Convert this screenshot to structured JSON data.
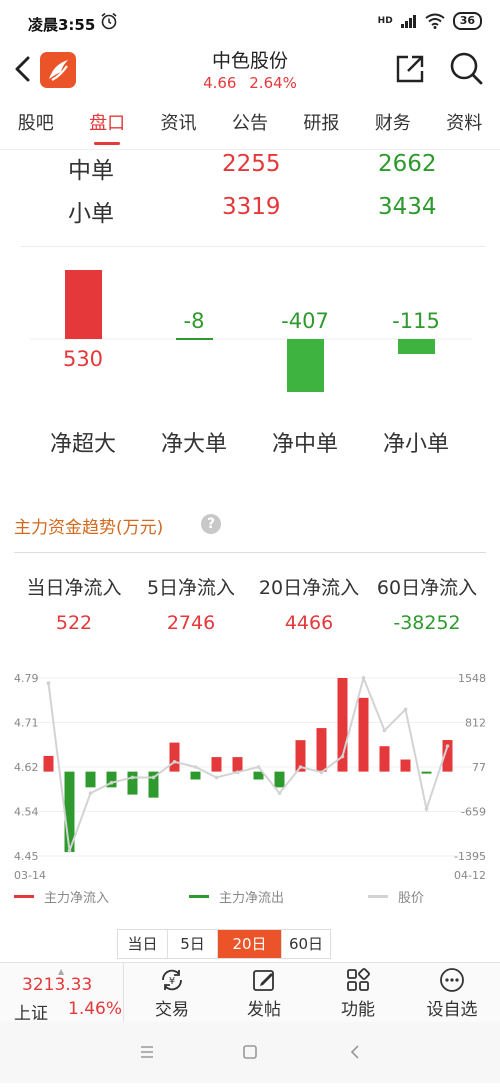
{
  "status_bar": {
    "time": "凌晨3:55",
    "signal": "HD",
    "battery": "36"
  },
  "header": {
    "stock_name": "中色股份",
    "price": "4.66",
    "change_pct": "2.64%"
  },
  "tabs": [
    {
      "label": "股吧",
      "active": false
    },
    {
      "label": "盘口",
      "active": true
    },
    {
      "label": "资讯",
      "active": false
    },
    {
      "label": "公告",
      "active": false
    },
    {
      "label": "研报",
      "active": false
    },
    {
      "label": "财务",
      "active": false
    },
    {
      "label": "资料",
      "active": false
    }
  ],
  "order_rows": [
    {
      "label": "中单",
      "inflow": "2255",
      "outflow": "2662"
    },
    {
      "label": "小单",
      "inflow": "3319",
      "outflow": "3434"
    }
  ],
  "net_flow": {
    "labels": [
      "净超大",
      "净大单",
      "净中单",
      "净小单"
    ],
    "values": [
      "530",
      "-8",
      "-407",
      "-115"
    ]
  },
  "trend": {
    "title": "主力资金趋势(万元)",
    "help": "?",
    "columns": [
      {
        "label": "当日净流入",
        "value": "522"
      },
      {
        "label": "5日净流入",
        "value": "2746"
      },
      {
        "label": "20日净流入",
        "value": "4466"
      },
      {
        "label": "60日净流入",
        "value": "-38252"
      }
    ]
  },
  "chart_data": {
    "type": "bar",
    "x_start": "03-14",
    "x_end": "04-12",
    "y_left_ticks": [
      "4.79",
      "4.71",
      "4.62",
      "4.54",
      "4.45"
    ],
    "y_right_ticks": [
      "1548",
      "812",
      "77",
      "-659",
      "-1395"
    ],
    "ylim_left": [
      4.45,
      4.79
    ],
    "ylim_right": [
      -1395,
      1548
    ],
    "series": [
      {
        "name": "主力净流入/主力净流出",
        "values": [
          260,
          -1330,
          -260,
          -260,
          -380,
          -430,
          480,
          -130,
          240,
          240,
          -130,
          -260,
          520,
          720,
          1548,
          1220,
          420,
          200,
          -20,
          522
        ]
      },
      {
        "name": "股价",
        "values": [
          4.78,
          4.46,
          4.57,
          4.59,
          4.6,
          4.6,
          4.63,
          4.62,
          4.6,
          4.61,
          4.62,
          4.57,
          4.62,
          4.61,
          4.64,
          4.79,
          4.69,
          4.73,
          4.54,
          4.66
        ]
      }
    ],
    "legend": [
      "主力净流入",
      "主力净流出",
      "股价"
    ],
    "colors": {
      "inflow": "#e5383b",
      "outflow": "#2e9a2e",
      "price": "#cccccc"
    }
  },
  "periods": [
    {
      "label": "当日",
      "active": false
    },
    {
      "label": "5日",
      "active": false
    },
    {
      "label": "20日",
      "active": true
    },
    {
      "label": "60日",
      "active": false
    }
  ],
  "bottom_bar": {
    "index_value": "3213.33",
    "index_name": "上证",
    "index_pct": "1.46%",
    "buttons": [
      {
        "label": "交易",
        "icon": "yen-refresh-icon"
      },
      {
        "label": "发帖",
        "icon": "pencil-icon"
      },
      {
        "label": "功能",
        "icon": "grid-icon"
      },
      {
        "label": "设自选",
        "icon": "more-dots-icon"
      }
    ]
  }
}
